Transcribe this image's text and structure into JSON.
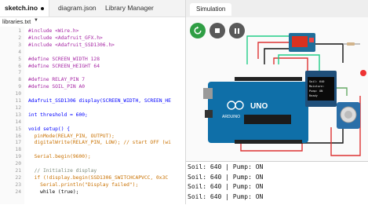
{
  "editor": {
    "tabs": [
      {
        "label": "sketch.ino",
        "active": true,
        "modified": true
      },
      {
        "label": "diagram.json",
        "active": false
      },
      {
        "label": "Library Manager",
        "active": false
      }
    ],
    "library_bar": "libraries.txt",
    "lines": [
      {
        "n": "1",
        "t": "#include <Wire.h>"
      },
      {
        "n": "2",
        "t": "#include <Adafruit_GFX.h>"
      },
      {
        "n": "3",
        "t": "#include <Adafruit_SSD1306.h>"
      },
      {
        "n": "4",
        "t": ""
      },
      {
        "n": "5",
        "t": "#define SCREEN_WIDTH 128"
      },
      {
        "n": "6",
        "t": "#define SCREEN_HEIGHT 64"
      },
      {
        "n": "7",
        "t": ""
      },
      {
        "n": "8",
        "t": "#define RELAY_PIN 7"
      },
      {
        "n": "9",
        "t": "#define SOIL_PIN A0"
      },
      {
        "n": "10",
        "t": ""
      },
      {
        "n": "11",
        "t": "Adafruit_SSD1306 display(SCREEN_WIDTH, SCREEN_HE"
      },
      {
        "n": "12",
        "t": ""
      },
      {
        "n": "13",
        "t": "int threshold = 600;"
      },
      {
        "n": "14",
        "t": ""
      },
      {
        "n": "15",
        "t": "void setup() {"
      },
      {
        "n": "16",
        "t": "  pinMode(RELAY_PIN, OUTPUT);"
      },
      {
        "n": "17",
        "t": "  digitalWrite(RELAY_PIN, LOW); // start OFF (wi"
      },
      {
        "n": "18",
        "t": ""
      },
      {
        "n": "19",
        "t": "  Serial.begin(9600);"
      },
      {
        "n": "20",
        "t": ""
      },
      {
        "n": "21",
        "t": "  // Initialize display"
      },
      {
        "n": "22",
        "t": "  if (!display.begin(SSD1306_SWITCHCAPVCC, 0x3C"
      },
      {
        "n": "23",
        "t": "    Serial.println(\"Display failed\");"
      },
      {
        "n": "24",
        "t": "    while (true);"
      }
    ]
  },
  "simulation": {
    "tab_label": "Simulation",
    "uno_label": "UNO",
    "arduino_label": "ARDUINO",
    "oled_lines": [
      "Soil: 640",
      "Moisture:",
      "Pump: ON",
      "Ready"
    ],
    "serial_lines": [
      "Soil: 640 | Pump: ON",
      "Soil: 640 | Pump: ON",
      "Soil: 640 | Pump: ON",
      "Soil: 640 | Pump: ON"
    ],
    "colors": {
      "play": "#2f9e44",
      "ctrl_gray": "#595959",
      "board": "#0f6fa8",
      "relay": "#d9311f"
    }
  }
}
